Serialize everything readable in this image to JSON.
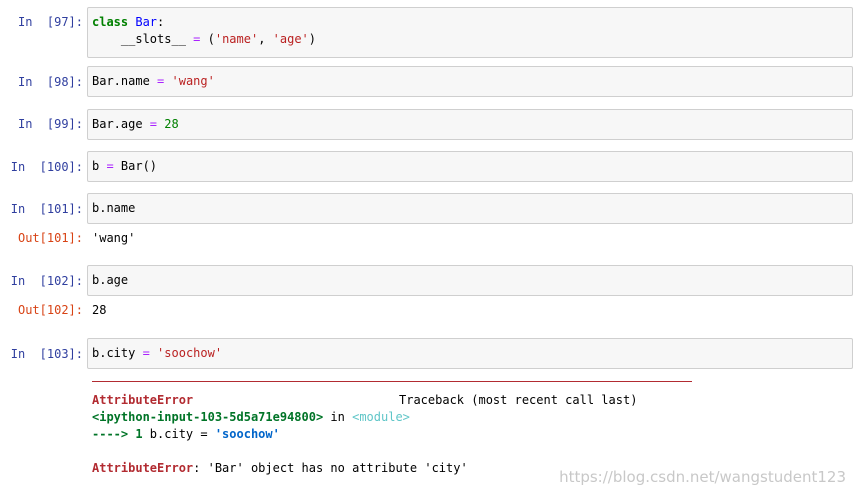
{
  "cells": {
    "c97": {
      "prompt": "In  [97]:",
      "line1": [
        "class",
        " ",
        "Bar",
        ":"
      ],
      "line2": [
        "    __slots__ ",
        "=",
        " (",
        "'name'",
        ", ",
        "'age'",
        ")"
      ]
    },
    "c98": {
      "prompt": "In  [98]:",
      "code": [
        "Bar.name ",
        "=",
        " ",
        "'wang'"
      ]
    },
    "c99": {
      "prompt": "In  [99]:",
      "code": [
        "Bar.age ",
        "=",
        " ",
        "28"
      ]
    },
    "c100": {
      "prompt": "In  [100]:",
      "code": [
        "b ",
        "=",
        " Bar()"
      ]
    },
    "c101": {
      "prompt": "In  [101]:",
      "code": "b.name",
      "out_prompt": "Out[101]:",
      "output": "'wang'"
    },
    "c102": {
      "prompt": "In  [102]:",
      "code": "b.age",
      "out_prompt": "Out[102]:",
      "output": "28"
    },
    "c103": {
      "prompt": "In  [103]:",
      "code": [
        "b.city ",
        "=",
        " ",
        "'soochow'"
      ]
    }
  },
  "traceback": {
    "error_name": "AttributeError",
    "header_right": "Traceback (most recent call last)",
    "input_ref": "<ipython-input-103-5d5a71e94800>",
    "in_word": " in ",
    "module": "<module>",
    "arrow": "----> 1",
    "arrow_code_pre": " b.city = ",
    "arrow_code_str": "'soochow'",
    "final_name": "AttributeError",
    "final_msg": ": 'Bar' object has no attribute 'city'"
  },
  "watermark": "https://blog.csdn.net/wangstudent123",
  "colors": {
    "in_prompt": "#303f9f",
    "out_prompt": "#d84315",
    "error_red": "#b22b31",
    "cell_bg": "#f7f7f7",
    "cell_border": "#cfcfcf"
  }
}
